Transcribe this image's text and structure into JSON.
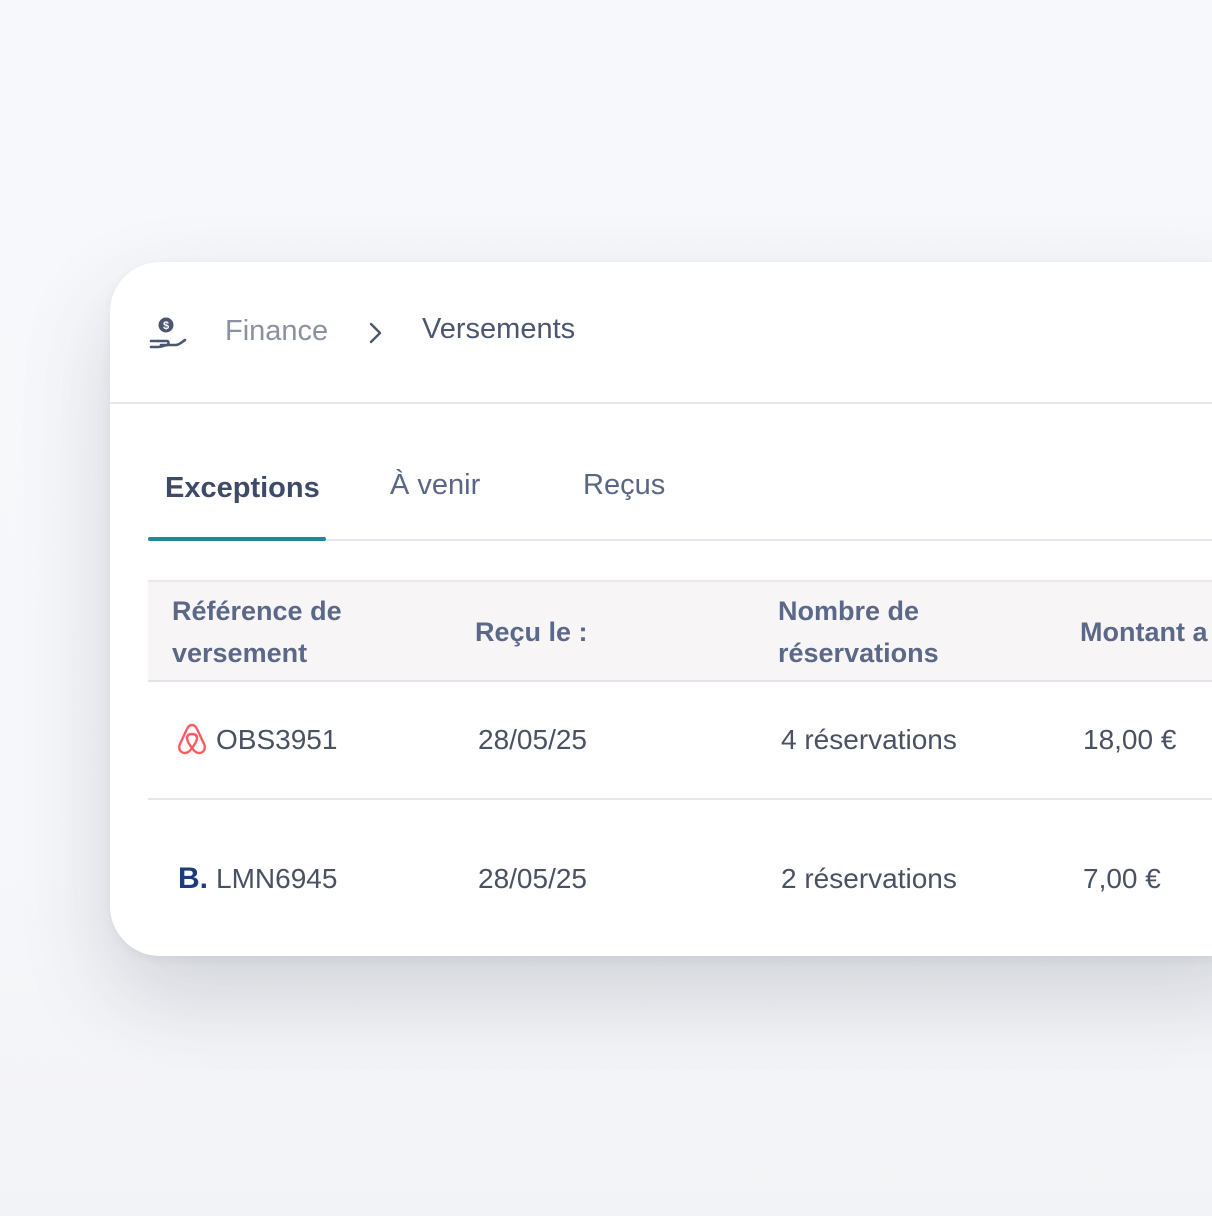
{
  "breadcrumb": {
    "section": "Finance",
    "current": "Versements",
    "section_icon": "hand-money-icon",
    "separator_icon": "chevron-right-icon"
  },
  "tabs": [
    {
      "label": "Exceptions",
      "active": true
    },
    {
      "label": "À venir",
      "active": false
    },
    {
      "label": "Reçus",
      "active": false
    }
  ],
  "table": {
    "columns": [
      "Référence de versement",
      "Reçu le :",
      "Nombre de réservations",
      "Montant a"
    ],
    "rows": [
      {
        "platform_icon": "airbnb-icon",
        "reference": "OBS3951",
        "received": "28/05/25",
        "bookings": "4 réservations",
        "amount": "18,00 €"
      },
      {
        "platform_icon": "booking-icon",
        "platform_logo_text": "B.",
        "reference": "LMN6945",
        "received": "28/05/25",
        "bookings": "2 réservations",
        "amount": "7,00 €"
      }
    ]
  },
  "colors": {
    "accent": "#1b8a9c",
    "airbnb": "#ff5a5f",
    "booking": "#1b3b7a",
    "text": "#4c5670"
  }
}
